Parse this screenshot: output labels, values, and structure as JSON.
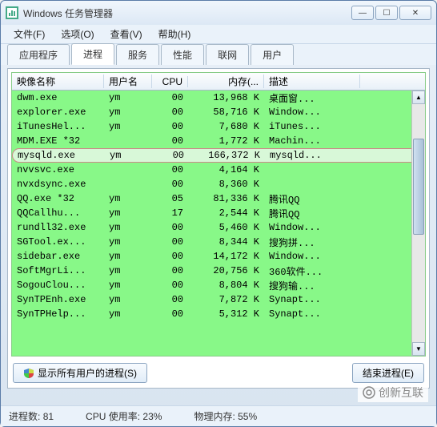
{
  "window": {
    "title": "Windows 任务管理器"
  },
  "menu": {
    "file": "文件(F)",
    "options": "选项(O)",
    "view": "查看(V)",
    "help": "帮助(H)"
  },
  "tabs": {
    "apps": "应用程序",
    "processes": "进程",
    "services": "服务",
    "performance": "性能",
    "networking": "联网",
    "users": "用户"
  },
  "columns": {
    "image_name": "映像名称",
    "user_name": "用户名",
    "cpu": "CPU",
    "memory": "内存(...",
    "description": "描述"
  },
  "rows": [
    {
      "name": "dwm.exe",
      "user": "ym",
      "cpu": "00",
      "mem": "13,968 K",
      "desc": "桌面窗...",
      "highlight": false
    },
    {
      "name": "explorer.exe",
      "user": "ym",
      "cpu": "00",
      "mem": "58,716 K",
      "desc": "Window...",
      "highlight": false
    },
    {
      "name": "iTunesHel...",
      "user": "ym",
      "cpu": "00",
      "mem": "7,680 K",
      "desc": "iTunes...",
      "highlight": false
    },
    {
      "name": "MDM.EXE *32",
      "user": "",
      "cpu": "00",
      "mem": "1,772 K",
      "desc": "Machin...",
      "highlight": false
    },
    {
      "name": "mysqld.exe",
      "user": "ym",
      "cpu": "00",
      "mem": "166,372 K",
      "desc": "mysqld...",
      "highlight": true
    },
    {
      "name": "nvvsvc.exe",
      "user": "",
      "cpu": "00",
      "mem": "4,164 K",
      "desc": "",
      "highlight": false
    },
    {
      "name": "nvxdsync.exe",
      "user": "",
      "cpu": "00",
      "mem": "8,360 K",
      "desc": "",
      "highlight": false
    },
    {
      "name": "QQ.exe *32",
      "user": "ym",
      "cpu": "05",
      "mem": "81,336 K",
      "desc": "腾讯QQ",
      "highlight": false
    },
    {
      "name": "QQCallhu...",
      "user": "ym",
      "cpu": "17",
      "mem": "2,544 K",
      "desc": "腾讯QQ",
      "highlight": false
    },
    {
      "name": "rundll32.exe",
      "user": "ym",
      "cpu": "00",
      "mem": "5,460 K",
      "desc": "Window...",
      "highlight": false
    },
    {
      "name": "SGTool.ex...",
      "user": "ym",
      "cpu": "00",
      "mem": "8,344 K",
      "desc": "搜狗拼...",
      "highlight": false
    },
    {
      "name": "sidebar.exe",
      "user": "ym",
      "cpu": "00",
      "mem": "14,172 K",
      "desc": "Window...",
      "highlight": false
    },
    {
      "name": "SoftMgrLi...",
      "user": "ym",
      "cpu": "00",
      "mem": "20,756 K",
      "desc": "360软件...",
      "highlight": false
    },
    {
      "name": "SogouClou...",
      "user": "ym",
      "cpu": "00",
      "mem": "8,804 K",
      "desc": "搜狗输...",
      "highlight": false
    },
    {
      "name": "SynTPEnh.exe",
      "user": "ym",
      "cpu": "00",
      "mem": "7,872 K",
      "desc": "Synapt...",
      "highlight": false
    },
    {
      "name": "SynTPHelp...",
      "user": "ym",
      "cpu": "00",
      "mem": "5,312 K",
      "desc": "Synapt...",
      "highlight": false
    }
  ],
  "buttons": {
    "show_all_users": "显示所有用户的进程(S)",
    "end_process": "结束进程(E)"
  },
  "status": {
    "process_count_label": "进程数:",
    "process_count": "81",
    "cpu_label": "CPU 使用率:",
    "cpu_value": "23%",
    "mem_label": "物理内存:",
    "mem_value": "55%"
  },
  "watermark": "创新互联"
}
